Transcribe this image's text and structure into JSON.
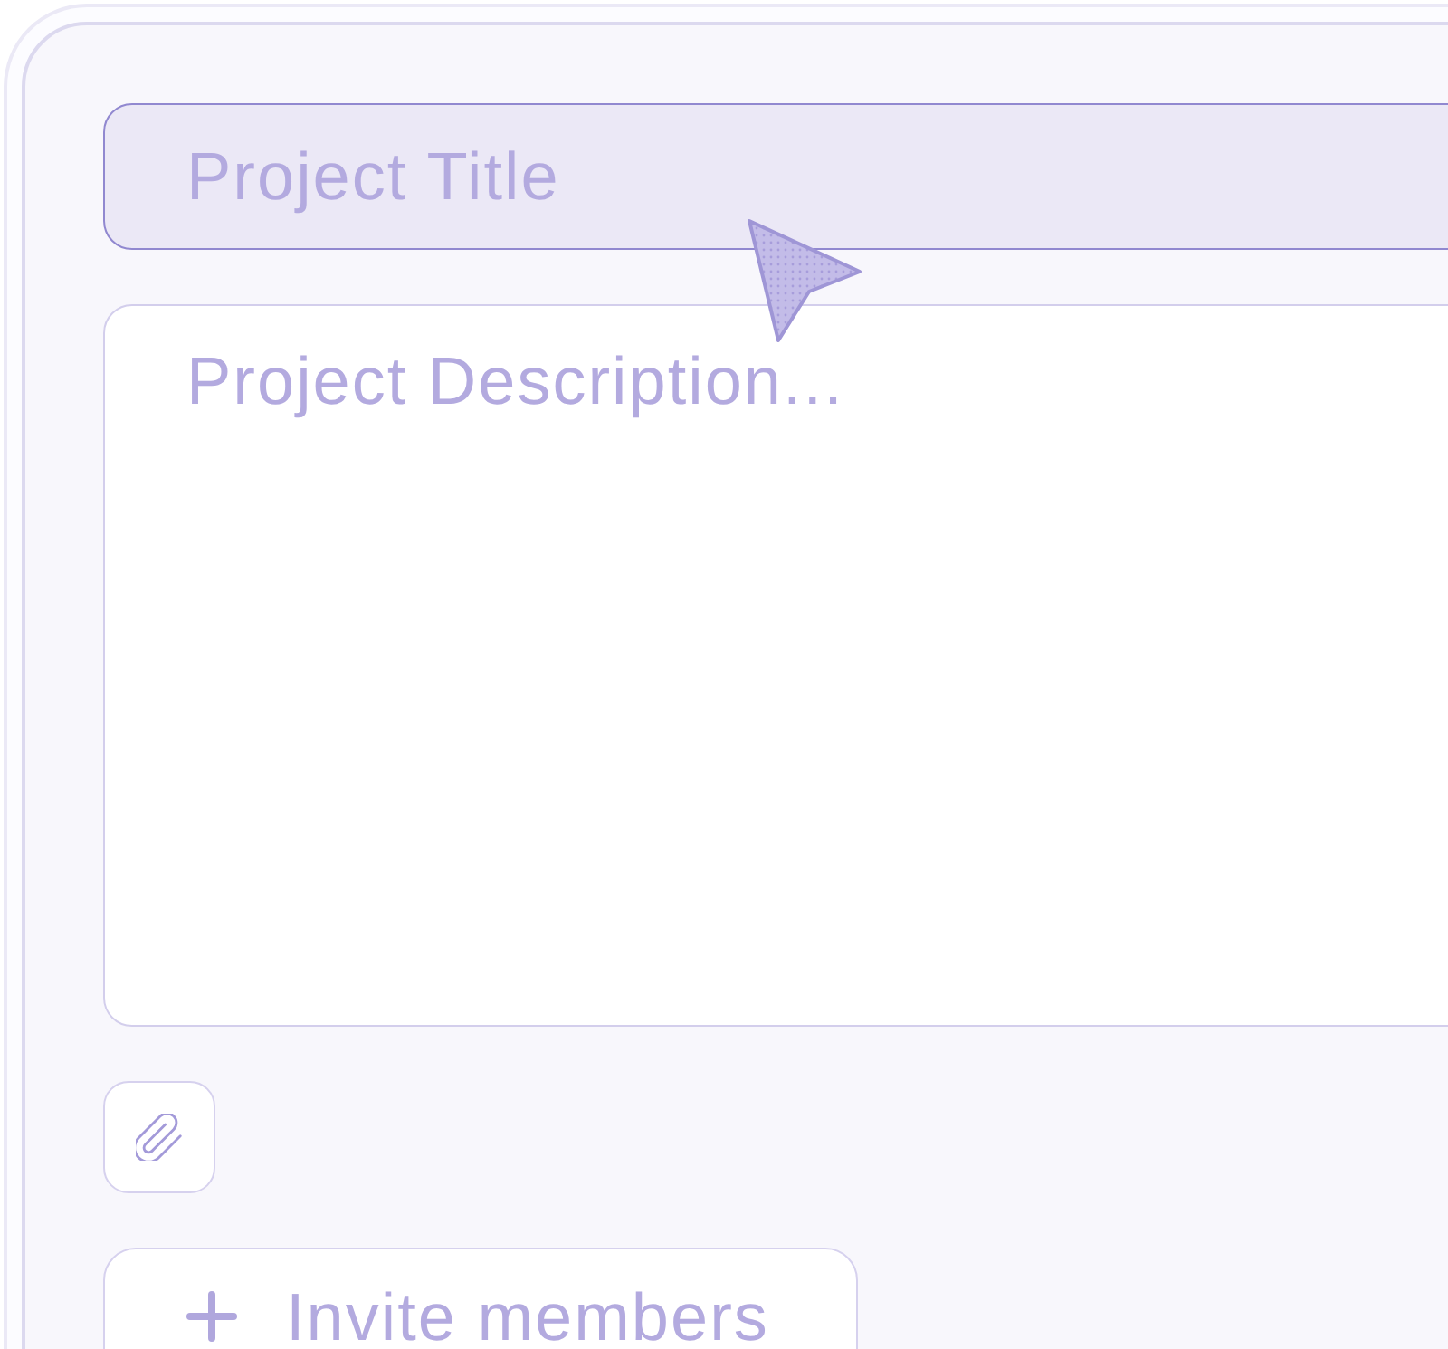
{
  "form": {
    "title_field": {
      "placeholder": "Project Title",
      "focused": true
    },
    "description_field": {
      "placeholder": "Project Description...",
      "focused": false
    },
    "invite_button": {
      "label": "Invite members"
    }
  }
}
